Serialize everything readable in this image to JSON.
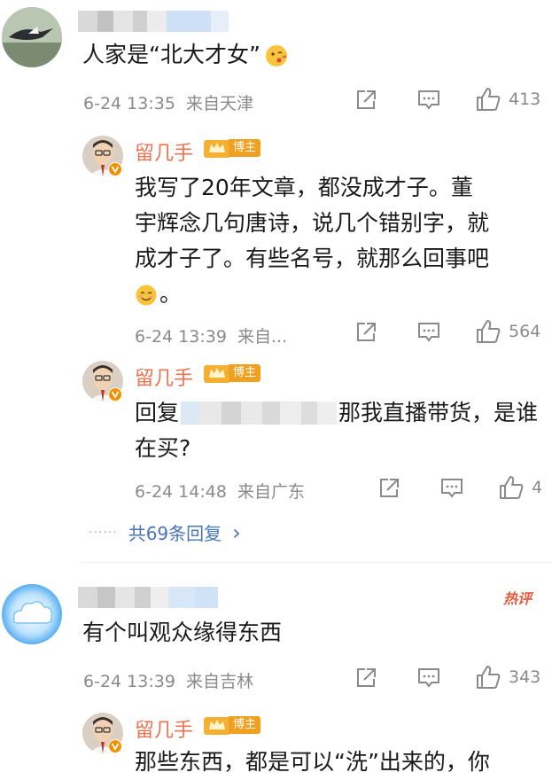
{
  "comments": [
    {
      "text": "人家是“北大才女”",
      "time": "6-24 13:35",
      "location": "来自天津",
      "likes": "413"
    },
    {
      "text": "有个叫观众缘得东西",
      "time": "6-24 13:39",
      "location": "来自吉林",
      "likes": "343",
      "hot_label": "热评"
    }
  ],
  "replies": [
    {
      "username": "留几手",
      "badge": "博主",
      "lines": [
        "我写了20年文章，都没成才子。董",
        "宇辉念几句唐诗，说几个错别字，就",
        "成才子了。有些名号，就那么回事吧",
        "。"
      ],
      "time": "6-24 13:39",
      "location": "来自...",
      "likes": "564"
    },
    {
      "username": "留几手",
      "badge": "博主",
      "prefix": "回复",
      "line1_tail": "那我直播带货，是谁",
      "line2": "在买?",
      "time": "6-24 14:48",
      "location": "来自广东",
      "likes": "4"
    },
    {
      "username": "留几手",
      "badge": "博主",
      "text": "那些东西，都是可以“洗”出来的，你"
    }
  ],
  "reply_summary": {
    "dots": "······",
    "label": "共69条回复",
    "arrow": "›"
  },
  "icons": {
    "share": "share-icon",
    "comment": "comment-icon",
    "like": "thumbs-up-icon",
    "emoji_kiss": "kiss-face-emoji",
    "emoji_smile": "smile-face-emoji",
    "verified": "verified-v-icon",
    "crown": "crown-icon"
  },
  "colors": {
    "username": "#eb7350",
    "link": "#4a76b8",
    "meta": "#8a8a8a",
    "badge": "#f0a020"
  }
}
